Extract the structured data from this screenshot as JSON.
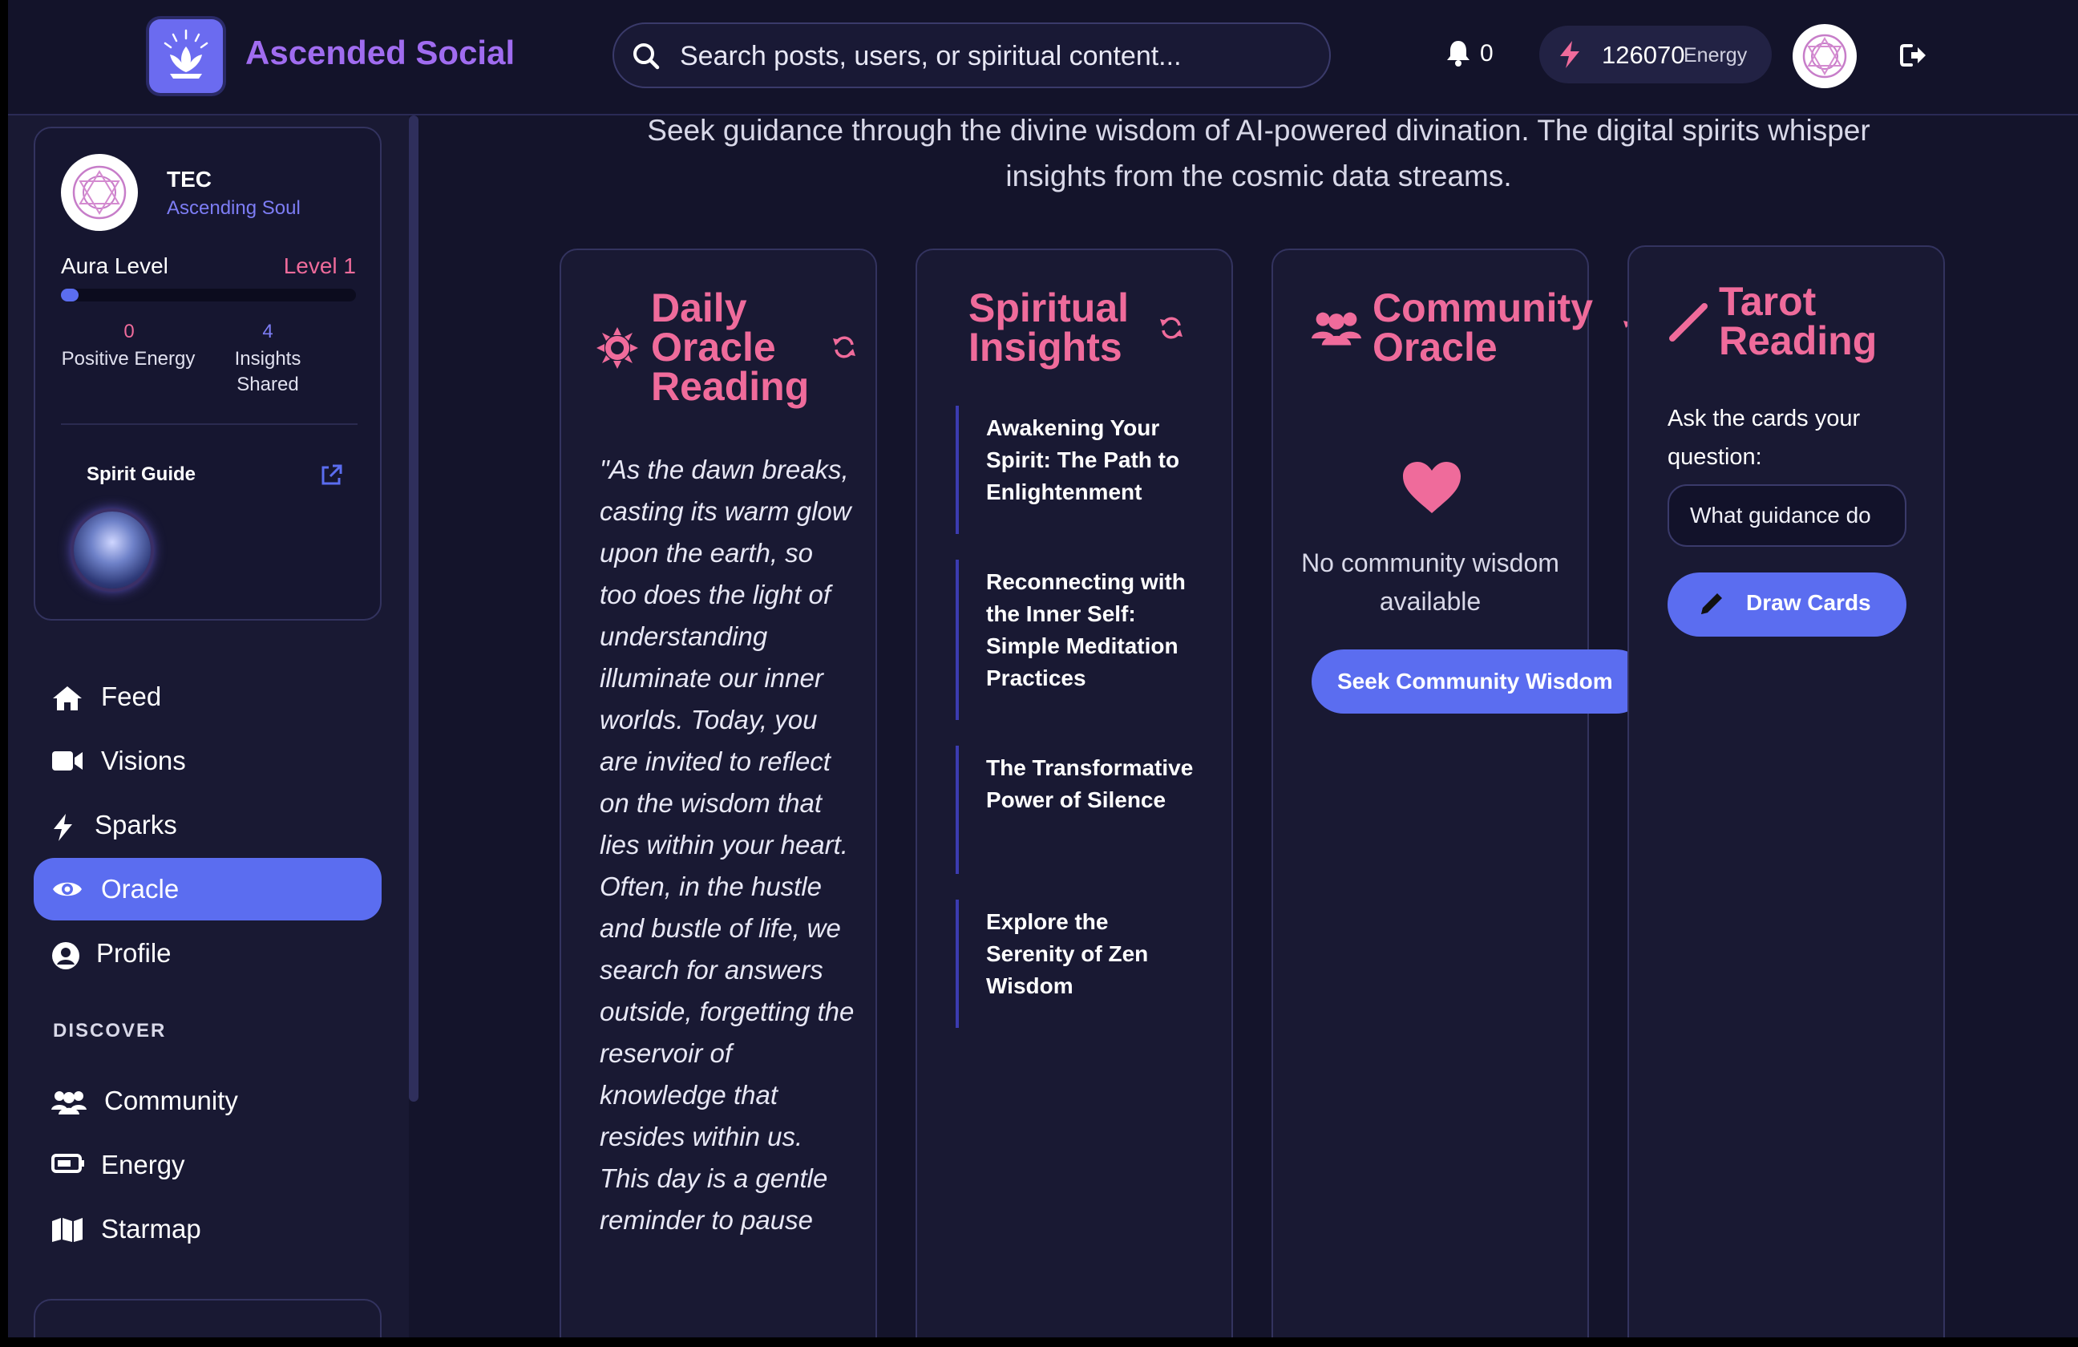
{
  "header": {
    "brand": "Ascended Social",
    "search_placeholder": "Search posts, users, or spiritual content...",
    "notifications_count": "0",
    "energy_value": "126070",
    "energy_label": "Energy"
  },
  "profile": {
    "name": "TEC",
    "title": "Ascending Soul",
    "aura_label": "Aura Level",
    "aura_level": "Level 1",
    "aura_progress": 0.06,
    "positive_energy_count": "0",
    "positive_energy_label": "Positive Energy",
    "insights_count": "4",
    "insights_label": "Insights Shared",
    "spirit_guide_label": "Spirit Guide"
  },
  "nav": {
    "feed": "Feed",
    "visions": "Visions",
    "sparks": "Sparks",
    "oracle": "Oracle",
    "profile": "Profile",
    "discover_heading": "DISCOVER",
    "community": "Community",
    "energy": "Energy",
    "starmap": "Starmap"
  },
  "main": {
    "intro": "Seek guidance through the divine wisdom of AI-powered divination. The digital spirits whisper insights from the cosmic data streams.",
    "daily_oracle": {
      "title": "Daily Oracle Reading",
      "text": "\"As the dawn breaks, casting its warm glow upon the earth, so too does the light of understanding illuminate our inner worlds. Today, you are invited to reflect on the wisdom that lies within your heart. Often, in the hustle and bustle of life, we search for answers outside, forgetting the reservoir of knowledge that resides within us. This day is a gentle reminder to pause"
    },
    "spiritual_insights": {
      "title": "Spiritual Insights",
      "items": [
        "Awakening Your Spirit: The Path to Enlightenment",
        "Reconnecting with the Inner Self: Simple Meditation Practices",
        "The Transformative Power of Silence",
        "Explore the Serenity of Zen Wisdom"
      ]
    },
    "community_oracle": {
      "title": "Community Oracle",
      "empty_text": "No community wisdom available",
      "button": "Seek Community Wisdom"
    },
    "tarot": {
      "title": "Tarot Reading",
      "prompt": "Ask the cards your question:",
      "input_placeholder": "What guidance do",
      "button": "Draw Cards"
    }
  },
  "colors": {
    "accent": "#5b6df0",
    "pink": "#ef6b9b",
    "brand_purple": "#a06cf0",
    "background": "#14142b"
  }
}
